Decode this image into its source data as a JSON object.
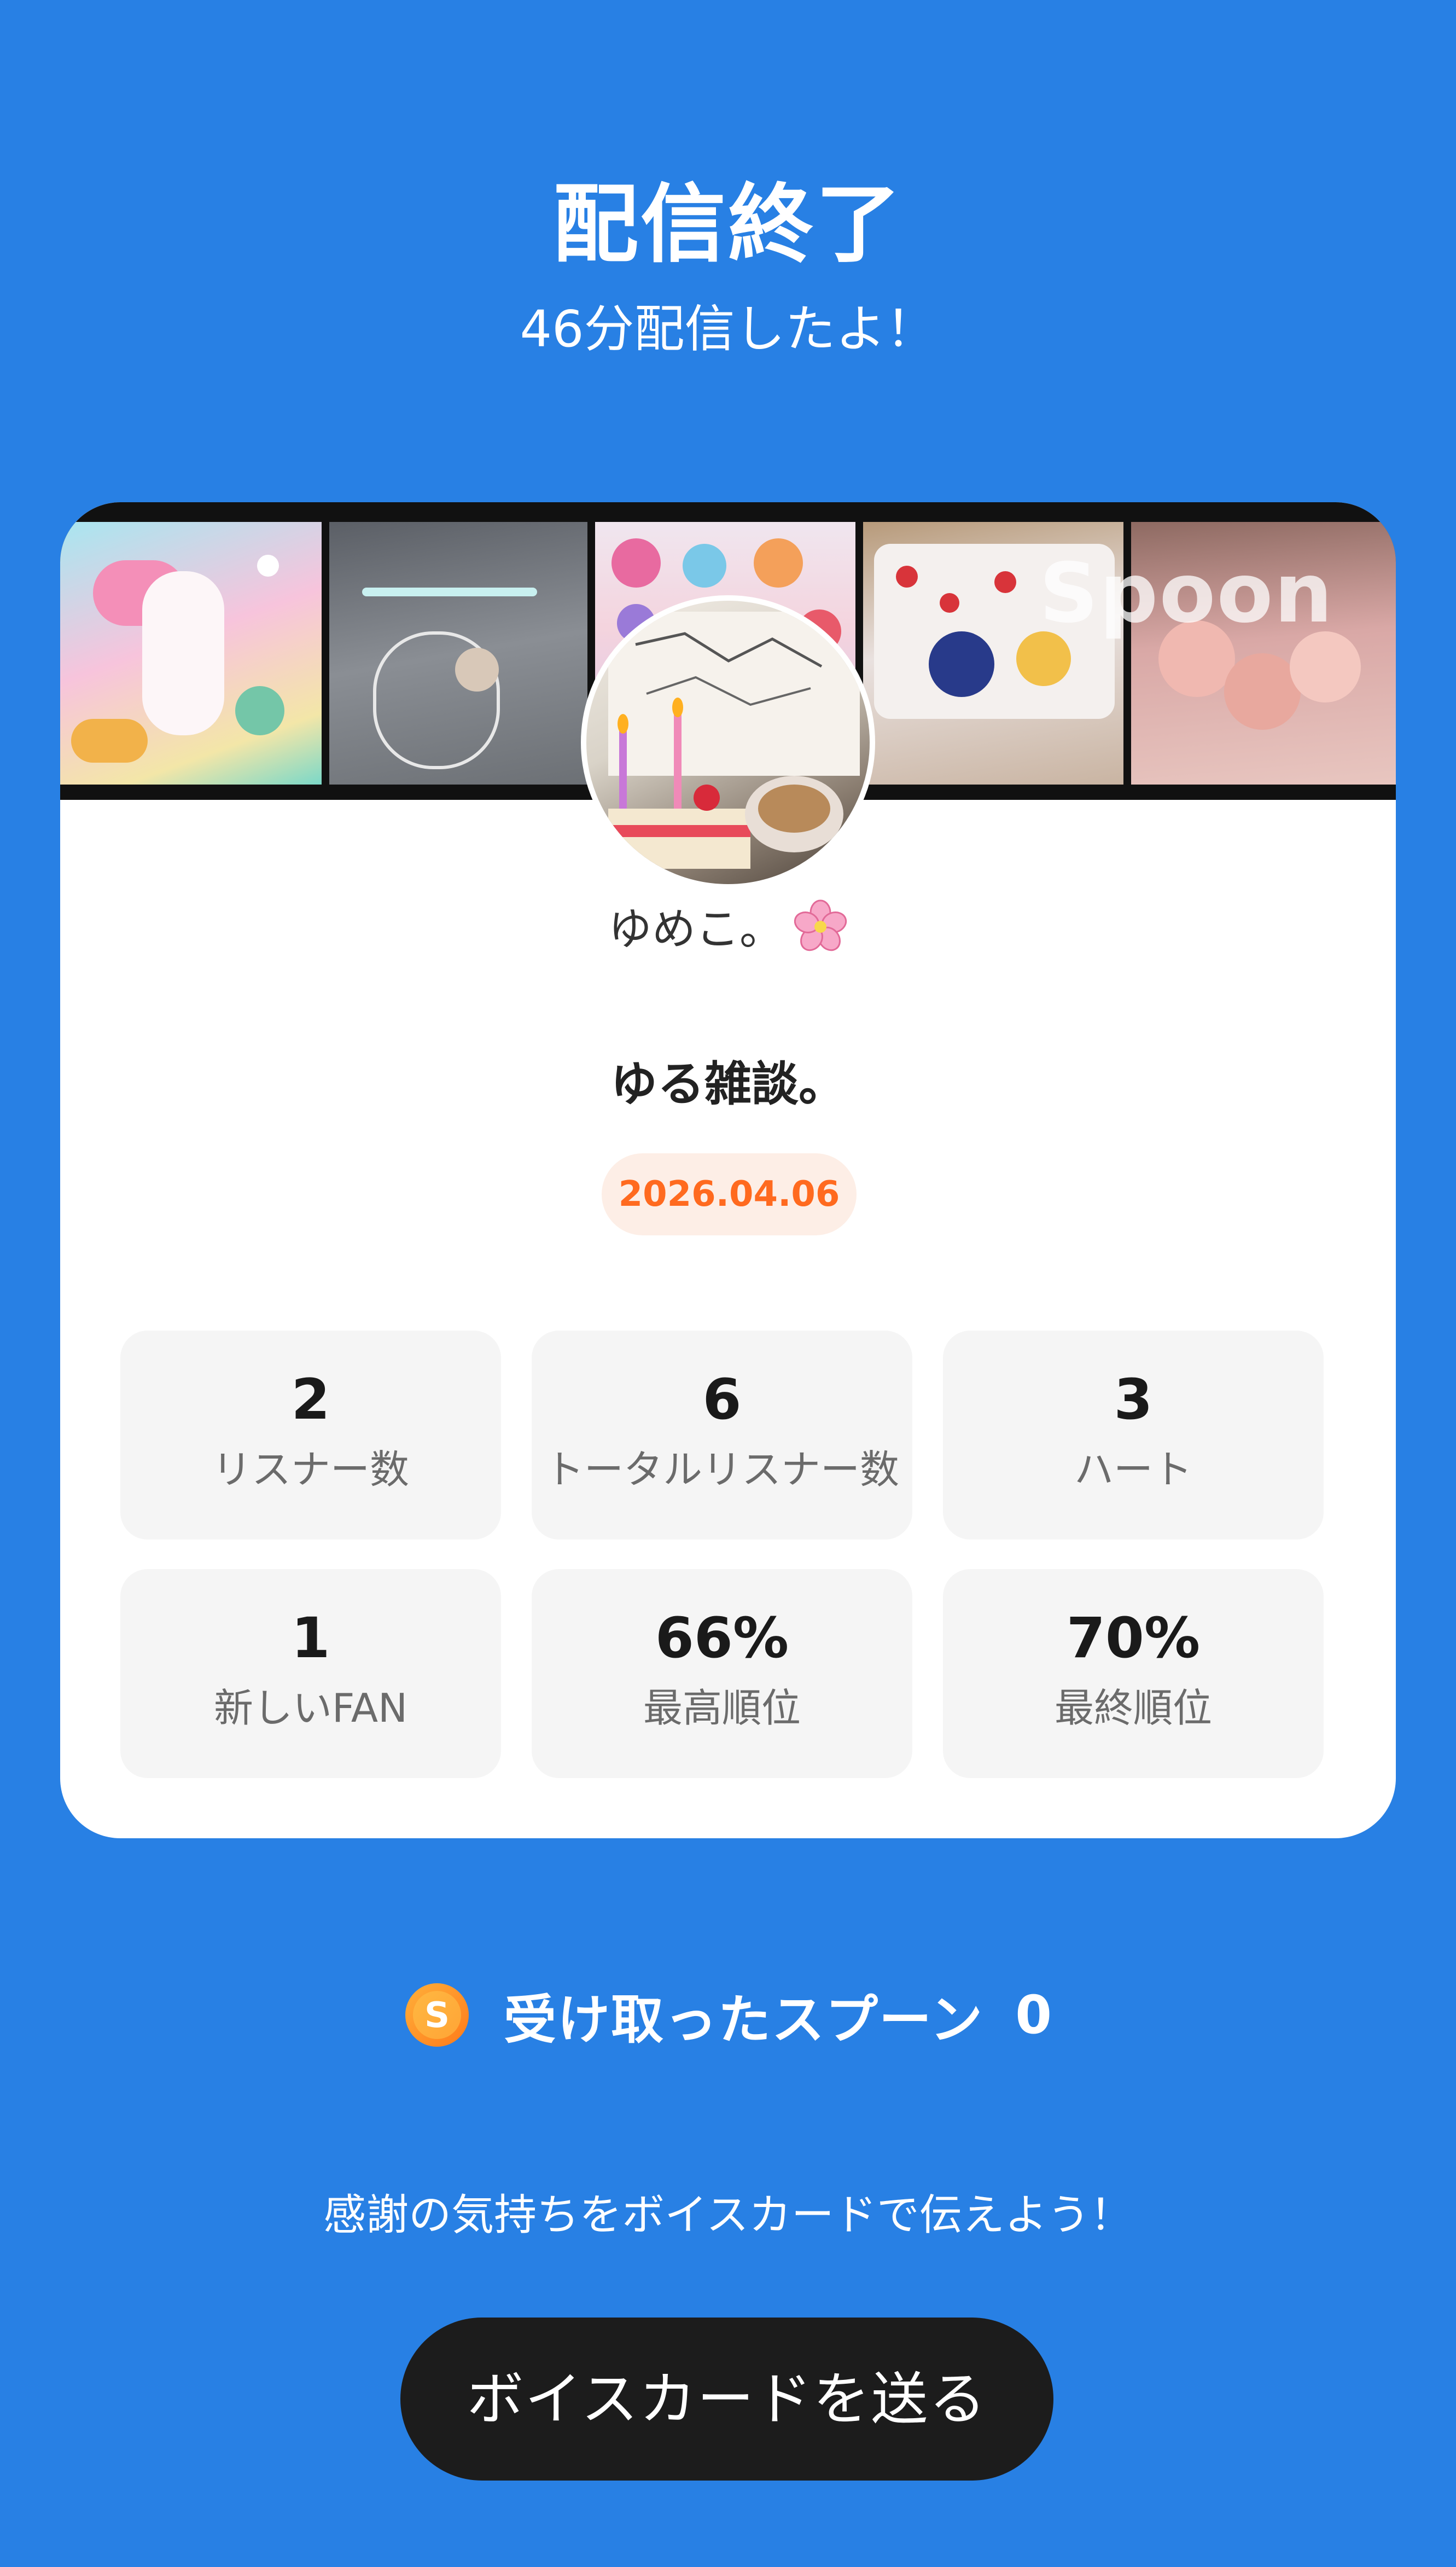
{
  "header": {
    "title": "配信終了",
    "subtitle": "46分配信したよ！"
  },
  "card": {
    "banner_watermark": "Spoon",
    "username": "ゆめこ。",
    "username_emoji_icon": "cherry-blossom-icon",
    "live_title": "ゆる雑談。",
    "date": "2026.04.06",
    "stats": [
      {
        "value": "2",
        "label": "リスナー数"
      },
      {
        "value": "6",
        "label": "トータルリスナー数"
      },
      {
        "value": "3",
        "label": "ハート"
      },
      {
        "value": "1",
        "label": "新しいFAN"
      },
      {
        "value": "66%",
        "label": "最高順位"
      },
      {
        "value": "70%",
        "label": "最終順位"
      }
    ]
  },
  "spoons": {
    "label": "受け取ったスプーン",
    "count": "0",
    "icon": "spoon-coin-icon"
  },
  "thanks_text": "感謝の気持ちをボイスカードで伝えよう！",
  "send_button_label": "ボイスカードを送る",
  "colors": {
    "background": "#2880e4",
    "card": "#ffffff",
    "stat_tile": "#f5f5f5",
    "date_badge_bg": "#fdeee6",
    "date_badge_text": "#ff6a1f",
    "button": "#1c1c1c"
  }
}
